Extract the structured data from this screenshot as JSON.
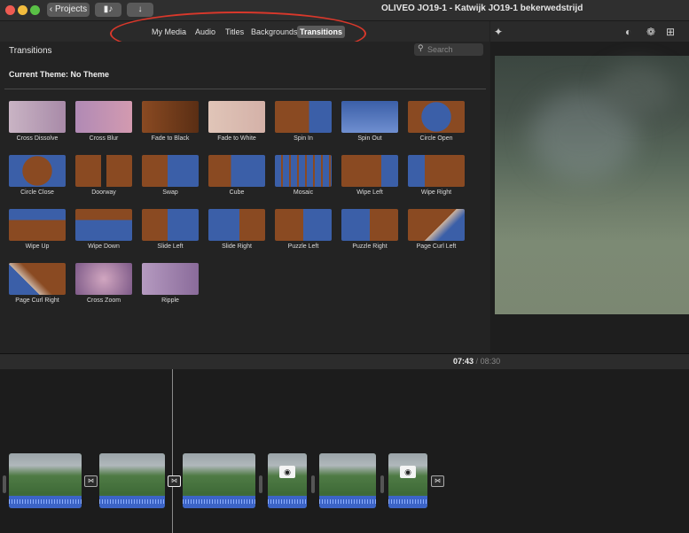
{
  "toolbar": {
    "projects_label": "Projects",
    "window_title": "OLIVEO JO19-1 - Katwijk JO19-1 bekerwedstrijd"
  },
  "tabs": [
    {
      "label": "My Media"
    },
    {
      "label": "Audio"
    },
    {
      "label": "Titles"
    },
    {
      "label": "Backgrounds"
    },
    {
      "label": "Transitions"
    }
  ],
  "browser": {
    "title": "Transitions",
    "search_placeholder": "Search",
    "theme": "Current Theme: No Theme",
    "tiles": [
      {
        "label": "Cross Dissolve"
      },
      {
        "label": "Cross Blur"
      },
      {
        "label": "Fade to Black"
      },
      {
        "label": "Fade to White"
      },
      {
        "label": "Spin In"
      },
      {
        "label": "Spin Out"
      },
      {
        "label": "Circle Open"
      },
      {
        "label": "Circle Close"
      },
      {
        "label": "Doorway"
      },
      {
        "label": "Swap"
      },
      {
        "label": "Cube"
      },
      {
        "label": "Mosaic"
      },
      {
        "label": "Wipe Left"
      },
      {
        "label": "Wipe Right"
      },
      {
        "label": "Wipe Up"
      },
      {
        "label": "Wipe Down"
      },
      {
        "label": "Slide Left"
      },
      {
        "label": "Slide Right"
      },
      {
        "label": "Puzzle Left"
      },
      {
        "label": "Puzzle Right"
      },
      {
        "label": "Page Curl Left"
      },
      {
        "label": "Page Curl Right"
      },
      {
        "label": "Cross Zoom"
      },
      {
        "label": "Ripple"
      }
    ]
  },
  "timeline": {
    "current_time": "07:43",
    "separator": "/",
    "total_time": "08:30"
  },
  "colors": {
    "active_tab": "#5b5b5b",
    "annotation_ellipse": "#d9382b",
    "audio_track": "#3c64c7",
    "forest_brown": "#8a4a22",
    "mountain_blue": "#3b5fa8"
  }
}
